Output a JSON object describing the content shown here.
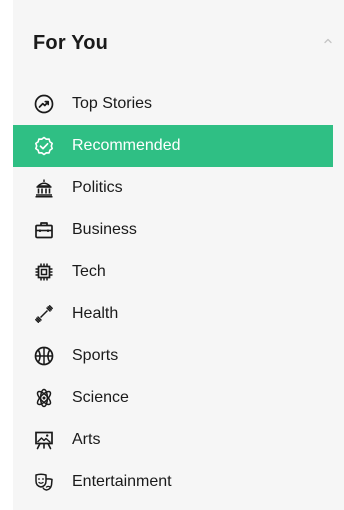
{
  "section": {
    "title": "For You",
    "collapse_icon": "chevron-up-icon"
  },
  "colors": {
    "active_background": "#2fbf84",
    "panel_background": "#f6f6f6",
    "text": "#1a1a1a"
  },
  "menu": {
    "items": [
      {
        "label": "Top Stories",
        "icon": "trending-up-icon",
        "active": false
      },
      {
        "label": "Recommended",
        "icon": "badge-check-icon",
        "active": true
      },
      {
        "label": "Politics",
        "icon": "capitol-building-icon",
        "active": false
      },
      {
        "label": "Business",
        "icon": "briefcase-icon",
        "active": false
      },
      {
        "label": "Tech",
        "icon": "chip-icon",
        "active": false
      },
      {
        "label": "Health",
        "icon": "dumbbell-icon",
        "active": false
      },
      {
        "label": "Sports",
        "icon": "basketball-icon",
        "active": false
      },
      {
        "label": "Science",
        "icon": "atom-icon",
        "active": false
      },
      {
        "label": "Arts",
        "icon": "easel-icon",
        "active": false
      },
      {
        "label": "Entertainment",
        "icon": "theater-masks-icon",
        "active": false
      }
    ]
  }
}
